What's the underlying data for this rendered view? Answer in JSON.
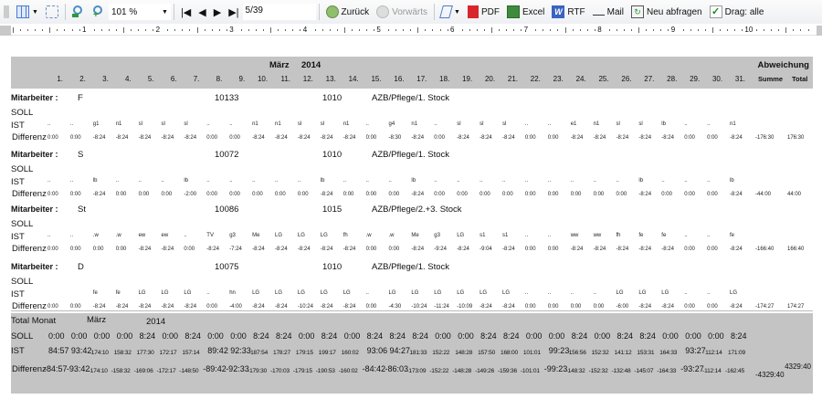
{
  "toolbar": {
    "zoom": "101 %",
    "page": "5/39",
    "back": "Zurück",
    "forward": "Vorwärts",
    "pdf": "PDF",
    "excel": "Excel",
    "rtf": "RTF",
    "mail": "Mail",
    "requery": "Neu abfragen",
    "drag": "Drag: alle"
  },
  "ruler": [
    "1",
    "2",
    "3",
    "4",
    "5",
    "6",
    "7",
    "8",
    "9",
    "10"
  ],
  "report": {
    "month": "März",
    "year": "2014",
    "deviation": "Abweichung",
    "summe": "Summe",
    "total": "Total",
    "days": [
      "1.",
      "2.",
      "3.",
      "4.",
      "5.",
      "6.",
      "7.",
      "8.",
      "9.",
      "10.",
      "11.",
      "12.",
      "13.",
      "14.",
      "15.",
      "16.",
      "17.",
      "18.",
      "19.",
      "20.",
      "21.",
      "22.",
      "23.",
      "24.",
      "25.",
      "26.",
      "27.",
      "28.",
      "29.",
      "30.",
      "31."
    ],
    "labels": {
      "employee": "Mitarbeiter :",
      "soll": "SOLL",
      "ist": "IST",
      "diff": "Differenz"
    },
    "employees": [
      {
        "name": "F",
        "id": "10133",
        "code": "1010",
        "unit": "AZB/Pflege/1. Stock",
        "ist": [
          "..",
          "..",
          "g1",
          "n1",
          "sl",
          "sl",
          "sl",
          "..",
          "..",
          "n1",
          "n1",
          "sl",
          "sl",
          "n1",
          "..",
          "g4",
          "n1",
          "..",
          "sl",
          "sl",
          "sl",
          "..",
          "..",
          "e1",
          "n1",
          "sl",
          "sl",
          "lb",
          "..",
          "..",
          "n1"
        ],
        "diff": [
          "0:00",
          "0:00",
          "-8:24",
          "-8:24",
          "-8:24",
          "-8:24",
          "-8:24",
          "0:00",
          "0:00",
          "-8:24",
          "-8:24",
          "-8:24",
          "-8:24",
          "-8:24",
          "0:00",
          "-8:30",
          "-8:24",
          "0:00",
          "-8:24",
          "-8:24",
          "-8:24",
          "0:00",
          "0:00",
          "-8:24",
          "-8:24",
          "-8:24",
          "-8:24",
          "-8:24",
          "0:00",
          "0:00",
          "-8:24"
        ],
        "summe": "-176:30",
        "total": "176:30"
      },
      {
        "name": "S",
        "id": "10072",
        "code": "1010",
        "unit": "AZB/Pflege/1. Stock",
        "ist": [
          "..",
          "..",
          "lb",
          "..",
          "..",
          "..",
          "lb",
          "..",
          "..",
          "..",
          "..",
          "..",
          "lb",
          "..",
          "..",
          "..",
          "lb",
          "..",
          "..",
          "..",
          "..",
          "..",
          "..",
          "..",
          "..",
          "..",
          "lb",
          "..",
          "..",
          "..",
          "lb"
        ],
        "diff": [
          "0:00",
          "0:00",
          "-8:24",
          "0:00",
          "0:00",
          "0:00",
          "-2:00",
          "0:00",
          "0:00",
          "0:00",
          "0:00",
          "0:00",
          "-8:24",
          "0:00",
          "0:00",
          "0:00",
          "-8:24",
          "0:00",
          "0:00",
          "0:00",
          "0:00",
          "0:00",
          "0:00",
          "0:00",
          "0:00",
          "0:00",
          "-8:24",
          "0:00",
          "0:00",
          "0:00",
          "-8:24"
        ],
        "summe": "-44:00",
        "total": "44:00"
      },
      {
        "name": "St",
        "id": "10086",
        "code": "1015",
        "unit": "AZB/Pflege/2.+3. Stock",
        "ist": [
          "..",
          "..",
          ".w",
          ".w",
          "ew",
          "ew",
          "..",
          "TV",
          "g3",
          "Me",
          "LG",
          "LG",
          "LG",
          "fh",
          ".w",
          ".w",
          "Me",
          "g3",
          "LG",
          "s1",
          "s1",
          "..",
          "..",
          "ww",
          "ww",
          "fh",
          "fe",
          "fe",
          "..",
          "..",
          "fe"
        ],
        "diff": [
          "0:00",
          "0:00",
          "0:00",
          "0:00",
          "-8:24",
          "-8:24",
          "0:00",
          "-8:24",
          "-7:24",
          "-8:24",
          "-8:24",
          "-8:24",
          "-8:24",
          "-8:24",
          "0:00",
          "0:00",
          "-8:24",
          "-9:24",
          "-8:24",
          "-9:04",
          "-8:24",
          "0:00",
          "0:00",
          "-8:24",
          "-8:24",
          "-8:24",
          "-8:24",
          "-8:24",
          "0:00",
          "0:00",
          "-8:24"
        ],
        "summe": "-166:40",
        "total": "166:40"
      },
      {
        "name": "D",
        "id": "10075",
        "code": "1010",
        "unit": "AZB/Pflege/1. Stock",
        "ist": [
          "",
          "",
          "fe",
          "fe",
          "LG",
          "LG",
          "LG",
          "..",
          "hn",
          "LG",
          "LG",
          "LG",
          "LG",
          "LG",
          "..",
          "LG",
          "LG",
          "LG",
          "LG",
          "LG",
          "LG",
          "..",
          "..",
          "..",
          "..",
          "LG",
          "LG",
          "LG",
          "..",
          "..",
          "LG"
        ],
        "diff": [
          "0:00",
          "0:00",
          "-8:24",
          "-8:24",
          "-8:24",
          "-8:24",
          "-8:24",
          "0:00",
          "-4:00",
          "-8:24",
          "-8:24",
          "-10:24",
          "-8:24",
          "-8:24",
          "0:00",
          "-4:30",
          "-10:24",
          "-11:24",
          "-10:09",
          "-8:24",
          "-8:24",
          "0:00",
          "0:00",
          "0:00",
          "0:00",
          "-6:00",
          "-8:24",
          "-8:24",
          "0:00",
          "0:00",
          "-8:24"
        ],
        "summe": "-174:27",
        "total": "174:27"
      }
    ],
    "totals": {
      "label": "Total Monat",
      "month": "März",
      "year": "2014",
      "soll": [
        "0:00",
        "0:00",
        "0:00",
        "0:00",
        "8:24",
        "0:00",
        "8:24",
        "0:00",
        "0:00",
        "8:24",
        "8:24",
        "0:00",
        "8:24",
        "0:00",
        "8:24",
        "8:24",
        "8:24",
        "0:00",
        "0:00",
        "8:24",
        "8:24",
        "0:00",
        "0:00",
        "8:24",
        "0:00",
        "8:24",
        "8:24",
        "0:00",
        "0:00",
        "0:00",
        "8:24"
      ],
      "ist": [
        "84:57",
        "93:42",
        "174:10",
        "158:32",
        "177:30",
        "172:17",
        "157:14",
        "89:42",
        "92:33",
        "187:54",
        "178:27",
        "179:15",
        "199:17",
        "160:02",
        "93:06",
        "94:27",
        "181:33",
        "152:22",
        "148:28",
        "157:50",
        "168:00",
        "101:01",
        "99:23",
        "156:56",
        "152:32",
        "141:12",
        "153:31",
        "164:33",
        "93:27",
        "112:14",
        "171:09"
      ],
      "diff": [
        "-84:57",
        "-93:42",
        "-174:10",
        "-158:32",
        "-169:06",
        "-172:17",
        "-148:50",
        "-89:42",
        "-92:33",
        "-179:30",
        "-170:03",
        "-179:15",
        "-190:53",
        "-160:02",
        "-84:42",
        "-86:03",
        "-173:09",
        "-152:22",
        "-148:28",
        "-149:26",
        "-159:36",
        "-101:01",
        "-99:23",
        "-148:32",
        "-152:32",
        "-132:48",
        "-145:07",
        "-164:33",
        "-93:27",
        "-112:14",
        "-162:45"
      ],
      "summe": "-4329:40",
      "total": "4329:40"
    }
  }
}
